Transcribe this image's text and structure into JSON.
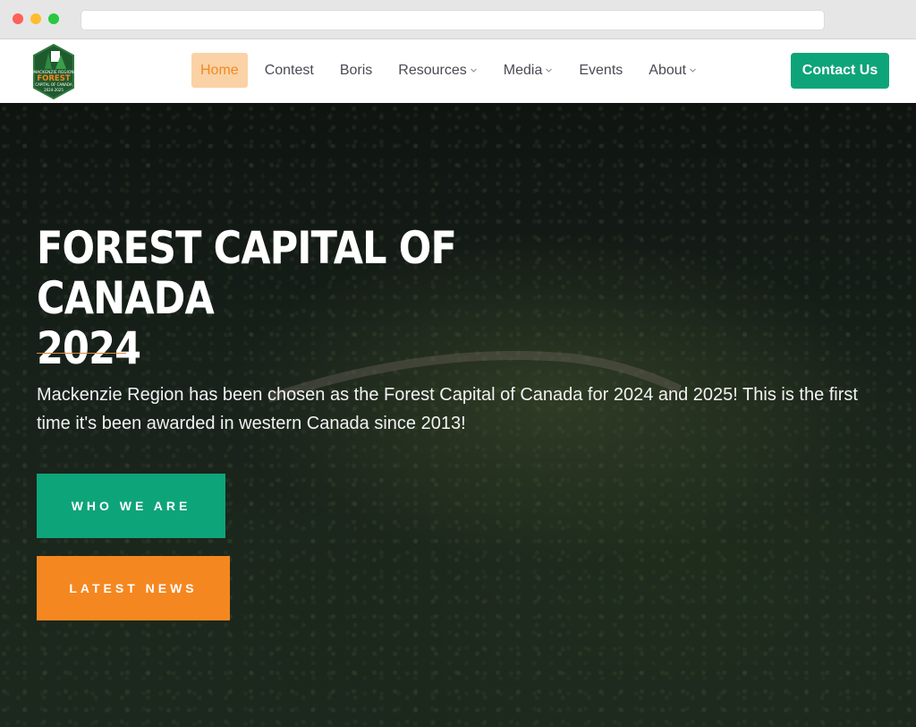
{
  "nav": {
    "items": [
      {
        "label": "Home",
        "active": true,
        "dropdown": false
      },
      {
        "label": "Contest",
        "active": false,
        "dropdown": false
      },
      {
        "label": "Boris",
        "active": false,
        "dropdown": false
      },
      {
        "label": "Resources",
        "active": false,
        "dropdown": true
      },
      {
        "label": "Media",
        "active": false,
        "dropdown": true
      },
      {
        "label": "Events",
        "active": false,
        "dropdown": false
      },
      {
        "label": "About",
        "active": false,
        "dropdown": true
      }
    ],
    "contact_label": "Contact Us"
  },
  "logo": {
    "line1": "MACKENZIE REGION",
    "line2": "FOREST",
    "line3": "CAPITAL OF CANADA",
    "line4": "2024-2025",
    "icon": "tree-hexagon-logo"
  },
  "hero": {
    "title_line1": "FOREST CAPITAL OF CANADA",
    "title_line2": "2024",
    "text": "Mackenzie Region has been chosen as the Forest Capital of Canada for 2024 and 2025! This is the first time it's been awarded in western Canada since 2013!",
    "button_primary": "WHO WE ARE",
    "button_secondary": "LATEST NEWS"
  },
  "colors": {
    "accent_green": "#0ea47a",
    "accent_orange": "#f58720",
    "nav_active_bg": "#fbd2a6",
    "nav_active_text": "#ef8a22"
  }
}
